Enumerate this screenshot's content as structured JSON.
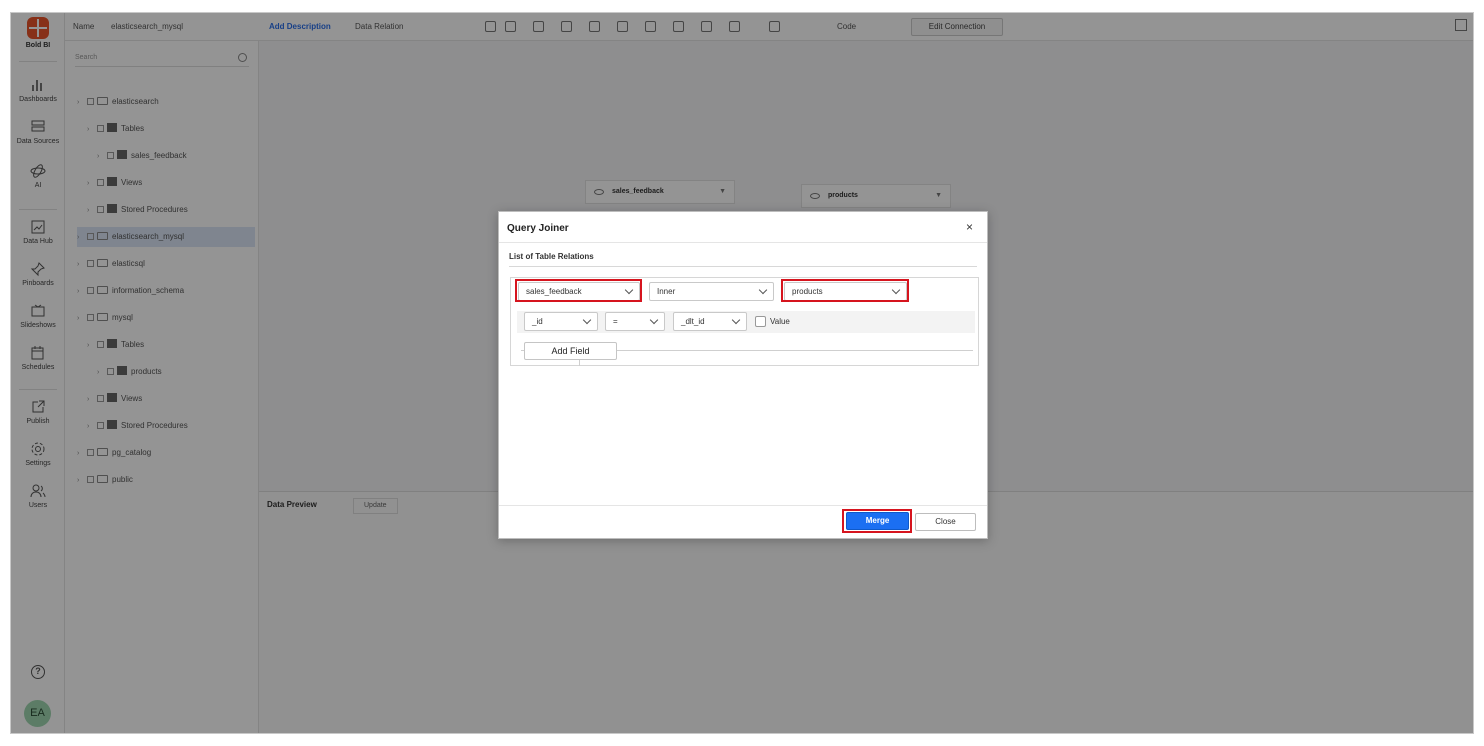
{
  "app": {
    "logo_text": "Bold BI"
  },
  "nav": {
    "items": [
      {
        "label": "Dashboards",
        "icon": "bar-chart-icon"
      },
      {
        "label": "Data Sources",
        "icon": "database-icon"
      },
      {
        "label": "AI",
        "icon": "atom-icon"
      },
      {
        "label": "Data Hub",
        "icon": "data-hub-icon"
      },
      {
        "label": "Pinboards",
        "icon": "pin-icon"
      },
      {
        "label": "Slideshows",
        "icon": "slideshow-icon"
      },
      {
        "label": "Schedules",
        "icon": "calendar-icon"
      },
      {
        "label": "Publish",
        "icon": "publish-icon"
      },
      {
        "label": "Settings",
        "icon": "gear-icon"
      },
      {
        "label": "Users",
        "icon": "users-icon"
      }
    ],
    "help_icon": "?",
    "avatar_initials": "EA"
  },
  "toolbar": {
    "name_label": "Name",
    "name_value": "elasticsearch_mysql",
    "add_description": "Add Description",
    "data_relation": "Data Relation",
    "code_label": "Code",
    "edit_connection": "Edit Connection"
  },
  "schema": {
    "search_placeholder": "Search",
    "tree": [
      {
        "label": "elasticsearch",
        "icon": "folder"
      },
      {
        "label": "Tables",
        "icon": "table"
      },
      {
        "label": "sales_feedback",
        "icon": "table"
      },
      {
        "label": "Views",
        "icon": "table"
      },
      {
        "label": "Stored Procedures",
        "icon": "table"
      },
      {
        "label": "elasticsearch_mysql",
        "icon": "folder"
      },
      {
        "label": "elasticsql",
        "icon": "folder"
      },
      {
        "label": "information_schema",
        "icon": "folder"
      },
      {
        "label": "mysql",
        "icon": "folder"
      },
      {
        "label": "Tables",
        "icon": "table"
      },
      {
        "label": "products",
        "icon": "table"
      },
      {
        "label": "Views",
        "icon": "table"
      },
      {
        "label": "Stored Procedures",
        "icon": "table"
      },
      {
        "label": "pg_catalog",
        "icon": "folder"
      },
      {
        "label": "public",
        "icon": "folder"
      }
    ]
  },
  "canvas": {
    "nodes": [
      "sales_feedback",
      "products"
    ],
    "bottom_tab": "Data Preview",
    "bottom_tab2": "Update"
  },
  "dialog": {
    "title": "Query Joiner",
    "close": "×",
    "subtitle": "List of Table Relations",
    "left_table": "sales_feedback",
    "join_type": "Inner",
    "right_table": "products",
    "left_field": "_id",
    "operator": "=",
    "right_field": "_dlt_id",
    "value_label": "Value",
    "add_field": "Add Field",
    "merge": "Merge",
    "close_button": "Close"
  }
}
